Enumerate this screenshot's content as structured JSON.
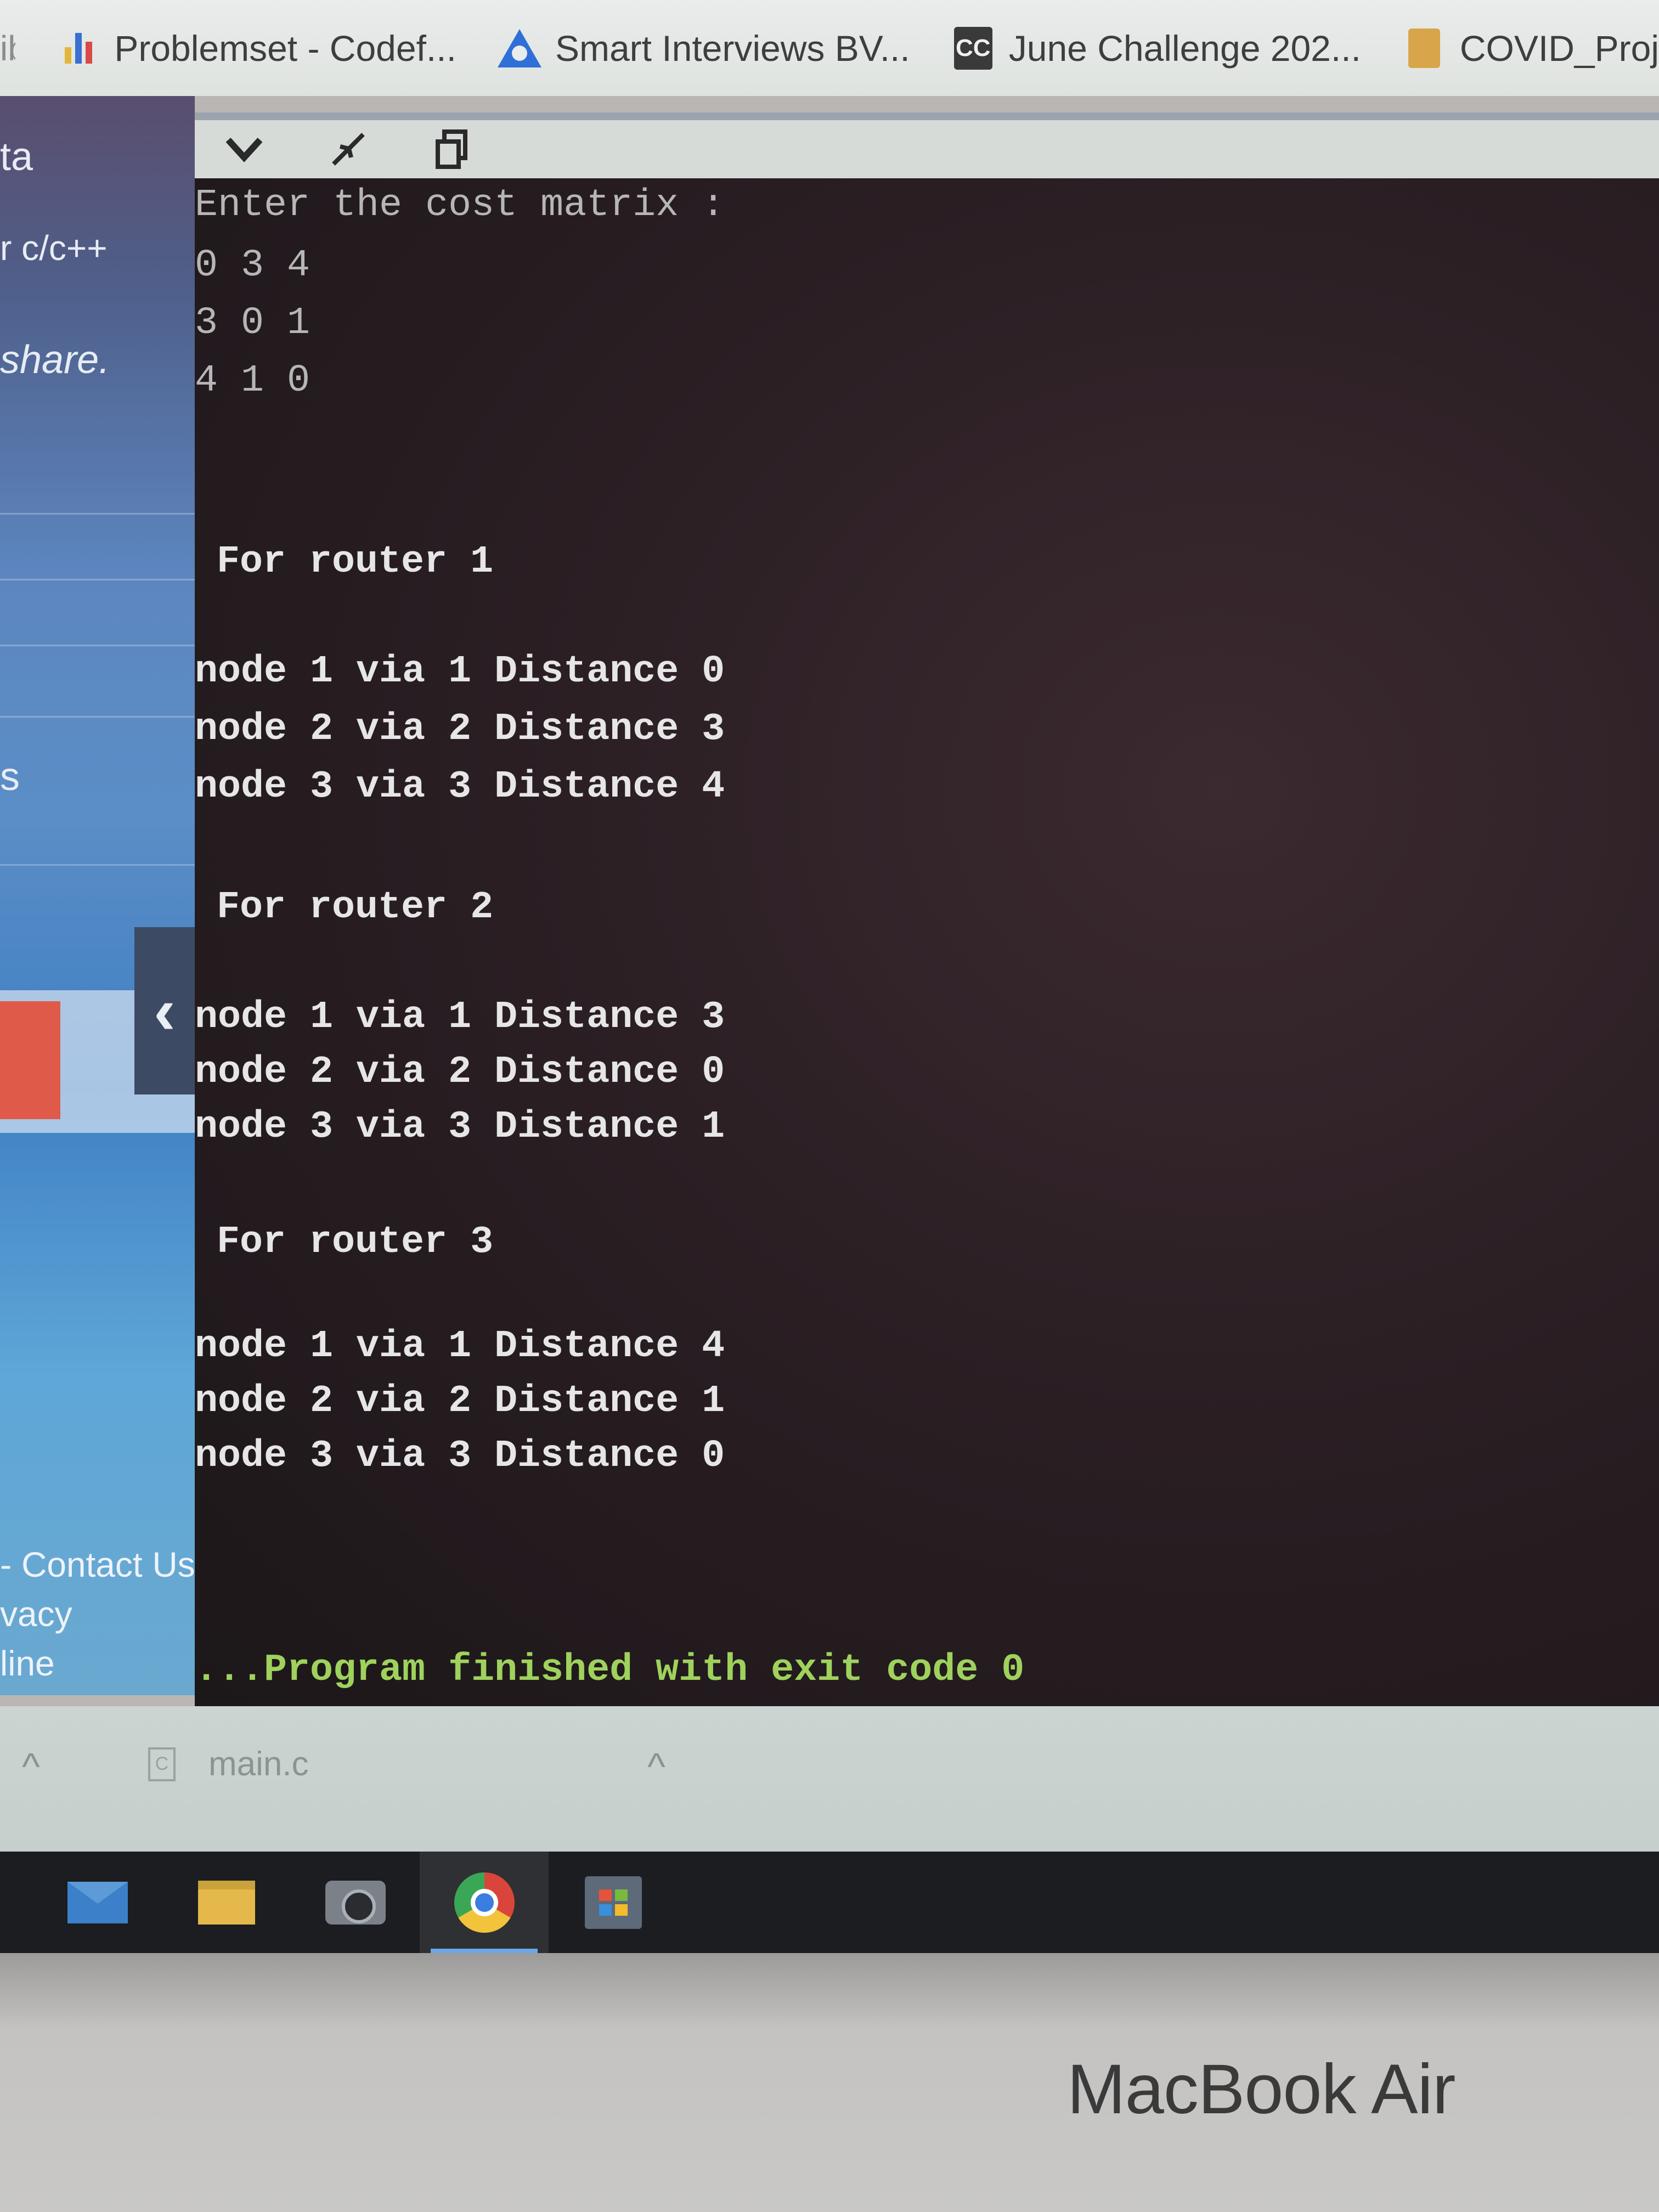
{
  "browser": {
    "bookmark_cut": "ibe",
    "bookmarks": [
      {
        "label": "Problemset - Codef...",
        "icon": "codeforces-icon"
      },
      {
        "label": "Smart Interviews BV...",
        "icon": "smart-interviews-icon"
      },
      {
        "label": "June Challenge 202...",
        "icon": "codechef-icon",
        "icon_text": "CC"
      },
      {
        "label": "COVID_Proj",
        "icon": "folder-icon"
      }
    ]
  },
  "website": {
    "cut_texts": [
      "ta",
      "r c/c++",
      "share.",
      "s"
    ],
    "footer_links": [
      "- Contact Us",
      "vacy",
      "line"
    ],
    "collapse_glyph": "‹"
  },
  "console": {
    "toolbar_icons": [
      "chevron-down-icon",
      "shrink-icon",
      "copy-icon"
    ],
    "prompt": "Enter the cost matrix :",
    "matrix": [
      "0 3 4",
      "3 0 1",
      "4 1 0"
    ],
    "routers": [
      {
        "header": "For router 1",
        "lines": [
          "node 1 via 1 Distance 0",
          "node 2 via 2 Distance 3",
          "node 3 via 3 Distance 4"
        ]
      },
      {
        "header": "For router 2",
        "lines": [
          "node 1 via 1 Distance 3",
          "node 2 via 2 Distance 0",
          "node 3 via 3 Distance 1"
        ]
      },
      {
        "header": "For router 3",
        "lines": [
          "node 1 via 1 Distance 4",
          "node 2 via 2 Distance 1",
          "node 3 via 3 Distance 0"
        ]
      }
    ],
    "finished": "...Program finished with exit code 0",
    "finish_color": "#9fd25c"
  },
  "tabs": {
    "file_label": "main.c",
    "file_icon_text": "C"
  },
  "taskbar": {
    "apps": [
      "mail-icon",
      "file-explorer-icon",
      "camera-icon",
      "chrome-icon",
      "store-icon"
    ],
    "active": "chrome-icon"
  },
  "laptop": {
    "brand": "MacBook Air"
  }
}
